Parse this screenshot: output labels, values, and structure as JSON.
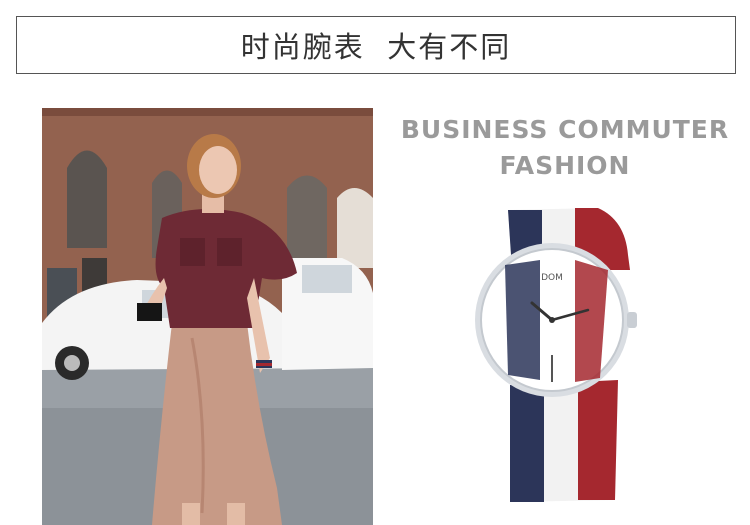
{
  "banner": {
    "title": "时尚腕表  大有不同"
  },
  "headline": {
    "line1": "BUSINESS COMMUTER",
    "line2": "FASHION"
  },
  "watch": {
    "brand": "DOM"
  },
  "colors": {
    "strap_navy": "#2c3559",
    "strap_white": "#f2f2f2",
    "strap_red": "#a5282f",
    "headline_gray": "#9a9a9a"
  }
}
